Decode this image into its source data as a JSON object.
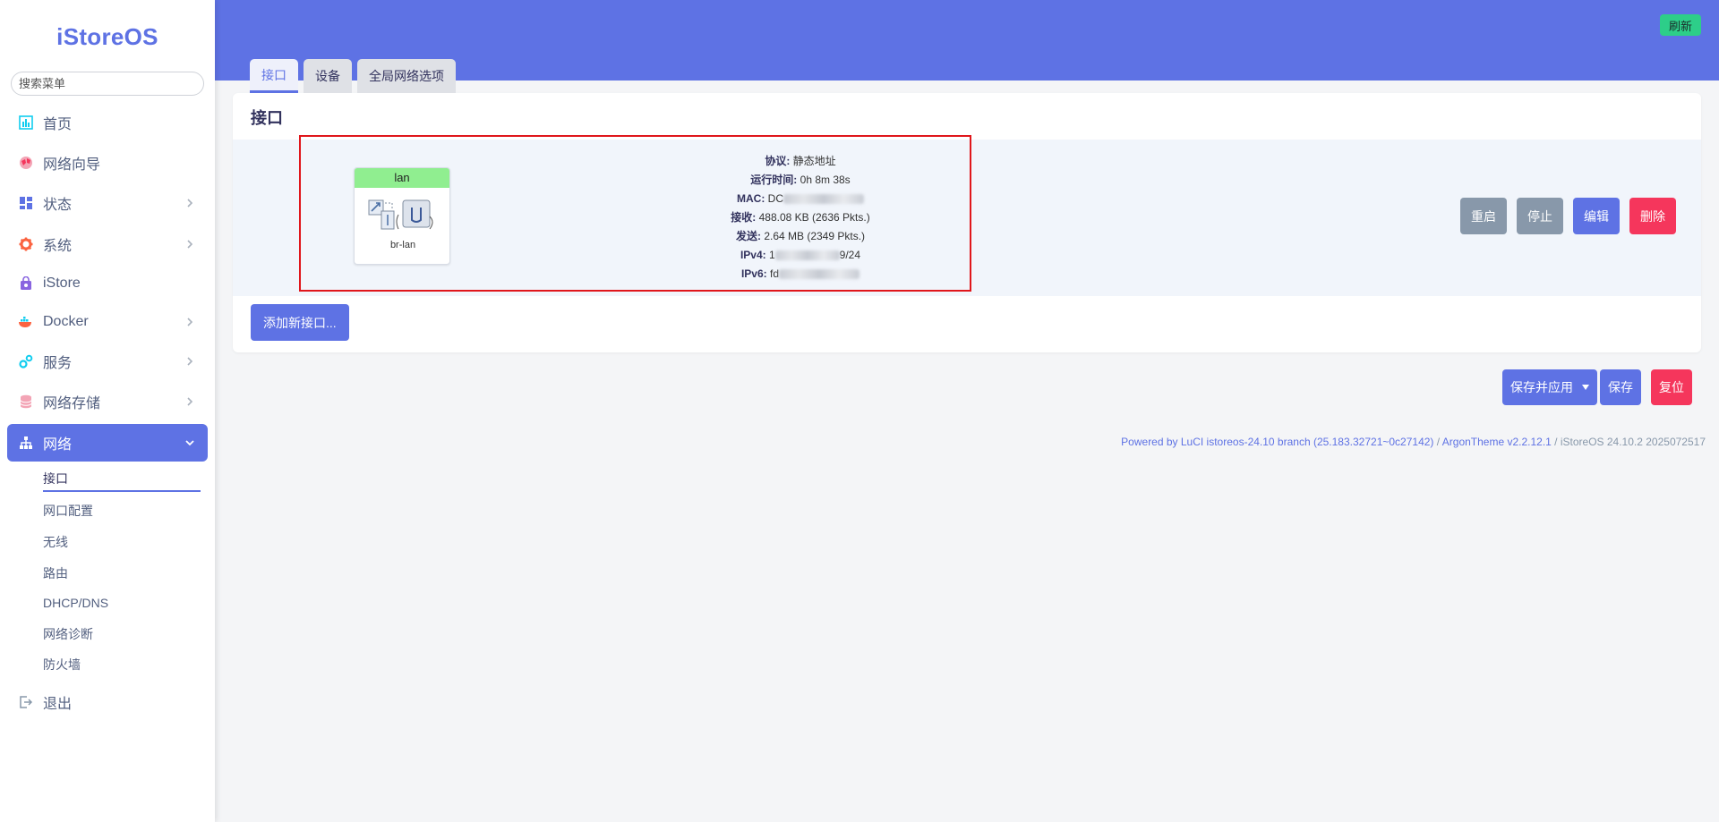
{
  "sidebar": {
    "logo": "iStoreOS",
    "search_placeholder": "搜索菜单",
    "items": [
      {
        "label": "首页",
        "icon": "dashboard-icon"
      },
      {
        "label": "网络向导",
        "icon": "globe-icon"
      },
      {
        "label": "状态",
        "icon": "status-grid-icon"
      },
      {
        "label": "系统",
        "icon": "gear-icon"
      },
      {
        "label": "iStore",
        "icon": "store-bag-icon"
      },
      {
        "label": "Docker",
        "icon": "docker-whale-icon"
      },
      {
        "label": "服务",
        "icon": "services-gears-icon"
      },
      {
        "label": "网络存储",
        "icon": "database-icon"
      },
      {
        "label": "网络",
        "icon": "network-tree-icon"
      }
    ],
    "network_subitems": [
      "接口",
      "网口配置",
      "无线",
      "路由",
      "DHCP/DNS",
      "网络诊断",
      "防火墙"
    ],
    "logout": "退出"
  },
  "header": {
    "refresh_label": "刷新",
    "tabs": [
      "接口",
      "设备",
      "全局网络选项"
    ]
  },
  "card": {
    "title": "接口",
    "interface": {
      "name": "lan",
      "device": "br-lan",
      "protocol_label": "协议:",
      "protocol_value": "静态地址",
      "uptime_label": "运行时间:",
      "uptime_value": "0h 8m 38s",
      "mac_label": "MAC:",
      "mac_value_visible": "DC",
      "rx_label": "接收:",
      "rx_value": "488.08 KB (2636 Pkts.)",
      "tx_label": "发送:",
      "tx_value": "2.64 MB (2349 Pkts.)",
      "ipv4_label": "IPv4:",
      "ipv4_prefix": "1",
      "ipv4_suffix": "9/24",
      "ipv6_label": "IPv6:",
      "ipv6_prefix": "fd"
    },
    "row_buttons": {
      "restart": "重启",
      "stop": "停止",
      "edit": "编辑",
      "delete": "删除"
    },
    "add_label": "添加新接口..."
  },
  "actions": {
    "save_apply": "保存并应用",
    "save": "保存",
    "reset": "复位"
  },
  "footer": {
    "powered": "Powered by LuCI istoreos-24.10 branch (25.183.32721~0c27142)",
    "sep1": " / ",
    "theme": "ArgonTheme v2.2.12.1",
    "sep2": " / ",
    "version": "iStoreOS 24.10.2 2025072517"
  },
  "colors": {
    "accent": "#5e72e4",
    "success": "#2dce89",
    "danger": "#f5365c",
    "secondary": "#8898aa",
    "badge_green": "#90ee90",
    "highlight_border": "#e0161b"
  }
}
